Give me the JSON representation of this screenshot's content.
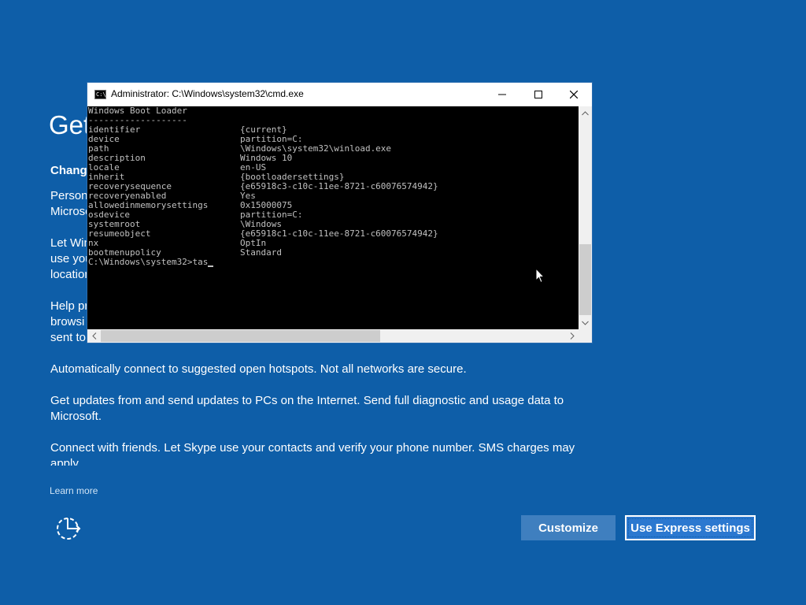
{
  "oobe": {
    "title": "Get",
    "subtitle": "Change",
    "paragraphs": [
      "Persona\nMicroso",
      "Let Win\nuse you\nlocation",
      "Help pr\nbrowsi\nsent to",
      "Automatically connect to suggested open hotspots. Not all networks are secure.",
      "Get updates from and send updates to PCs on the Internet. Send full diagnostic and usage data to Microsoft.",
      "Connect with friends. Let Skype use your contacts and verify your phone number. SMS charges may apply."
    ],
    "learn_more": "Learn more",
    "customize_label": "Customize",
    "express_label": "Use Express settings",
    "accessibility_icon": "ease-of-access-icon"
  },
  "cmd": {
    "title": "Administrator: C:\\Windows\\system32\\cmd.exe",
    "app_icon_text": "C:\\",
    "header": "Windows Boot Loader",
    "underline": "-------------------",
    "entries": [
      {
        "k": "identifier",
        "v": "{current}"
      },
      {
        "k": "device",
        "v": "partition=C:"
      },
      {
        "k": "path",
        "v": "\\Windows\\system32\\winload.exe"
      },
      {
        "k": "description",
        "v": "Windows 10"
      },
      {
        "k": "locale",
        "v": "en-US"
      },
      {
        "k": "inherit",
        "v": "{bootloadersettings}"
      },
      {
        "k": "recoverysequence",
        "v": "{e65918c3-c10c-11ee-8721-c60076574942}"
      },
      {
        "k": "recoveryenabled",
        "v": "Yes"
      },
      {
        "k": "allowedinmemorysettings",
        "v": "0x15000075"
      },
      {
        "k": "osdevice",
        "v": "partition=C:"
      },
      {
        "k": "systemroot",
        "v": "\\Windows"
      },
      {
        "k": "resumeobject",
        "v": "{e65918c1-c10c-11ee-8721-c60076574942}"
      },
      {
        "k": "nx",
        "v": "OptIn"
      },
      {
        "k": "bootmenupolicy",
        "v": "Standard"
      }
    ],
    "prompt": "C:\\Windows\\system32>tas"
  },
  "colors": {
    "background": "#0e5ea8",
    "console_bg": "#000000",
    "console_text": "#c0c0c0"
  }
}
